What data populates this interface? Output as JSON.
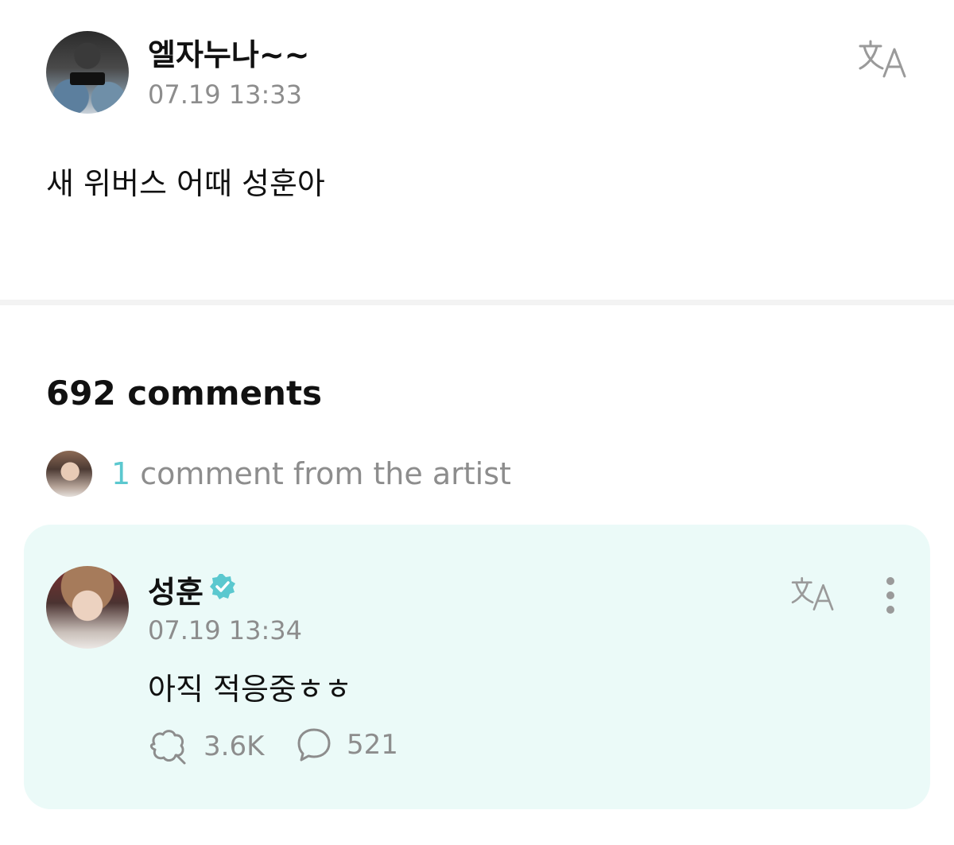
{
  "post": {
    "author": "엘자누나~~",
    "timestamp": "07.19 13:33",
    "body": "새 위버스 어때 성훈아",
    "translate_icon": "translate-icon"
  },
  "comments": {
    "count_label": "692 comments",
    "artist_summary": {
      "count": "1",
      "label": "comment from the artist"
    }
  },
  "artist_comment": {
    "author": "성훈",
    "verified_icon": "verified-badge-icon",
    "timestamp": "07.19 13:34",
    "text": "아직 적응중ㅎㅎ",
    "likes": "3.6K",
    "replies": "521",
    "accent_color": "#5bc8cf",
    "card_color": "#ebfaf8"
  }
}
